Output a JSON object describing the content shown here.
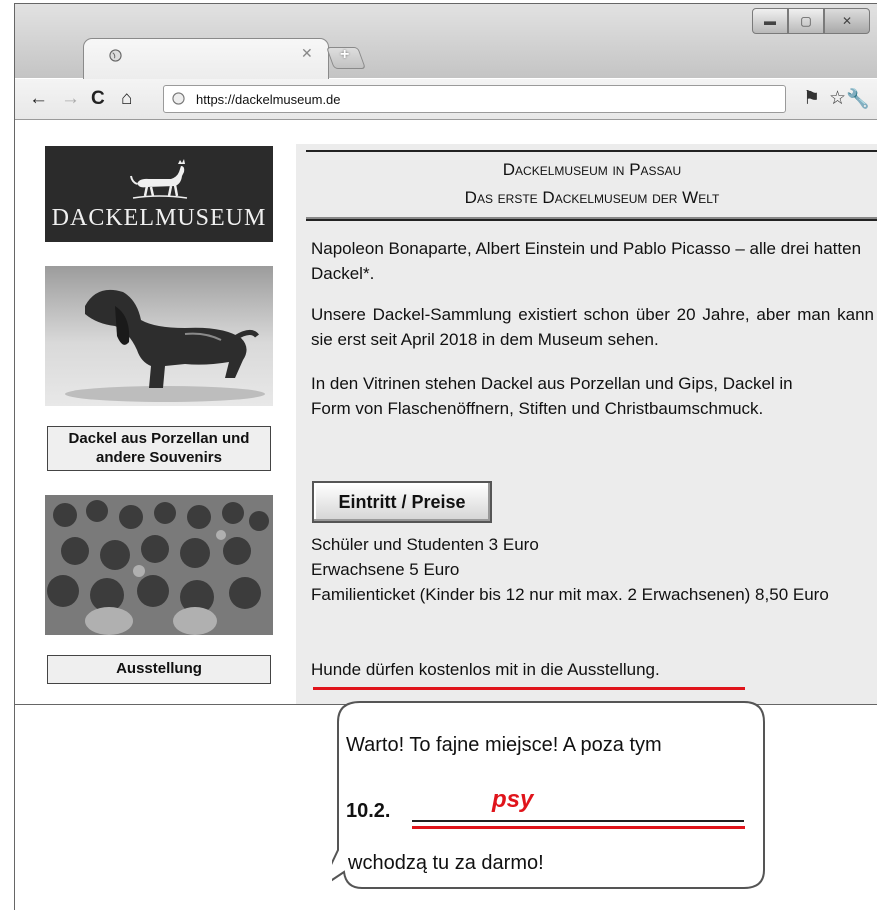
{
  "browser": {
    "url": "https://dackelmuseum.de",
    "icons": {
      "back": "back-arrow-icon",
      "forward": "forward-arrow-icon",
      "reload": "reload-icon",
      "home": "home-icon",
      "bookmark_flag": "flag-icon",
      "star": "star-icon",
      "wrench": "wrench-icon"
    }
  },
  "sidebar": {
    "logo_text": "DACKELMUSEUM",
    "caption1": "Dackel aus Porzellan und andere Souvenirs",
    "caption2": "Ausstellung"
  },
  "main": {
    "header_line1": "Dackelmuseum in Passau",
    "header_line2": "Das erste Dackelmuseum der Welt",
    "para1": "Napoleon Bonaparte, Albert Einstein und Pablo Picasso – alle drei hatten Dackel*.",
    "para2": "Unsere Dackel-Sammlung existiert schon über 20 Jahre, aber man kann sie erst seit April 2018 in dem Museum sehen.",
    "para3": "In den Vitrinen stehen Dackel aus Porzellan und Gips, Dackel in Form von Flaschenöffnern, Stiften und Christbaumschmuck.",
    "price_button": "Eintritt / Preise",
    "price1": "Schüler und Studenten 3 Euro",
    "price2": "Erwachsene 5 Euro",
    "price3": "Familienticket (Kinder bis 12 nur mit max. 2 Erwachsenen) 8,50 Euro",
    "note": "Hunde dürfen kostenlos mit in die Ausstellung."
  },
  "bubble": {
    "line1": "Warto! To fajne miejsce! A poza tym",
    "number": "10.2.",
    "answer": "psy",
    "line3": "wchodzą tu za darmo!"
  },
  "colors": {
    "accent_red": "#e0141b",
    "page_bg": "#ececec",
    "logo_bg": "#2b2b2b"
  }
}
